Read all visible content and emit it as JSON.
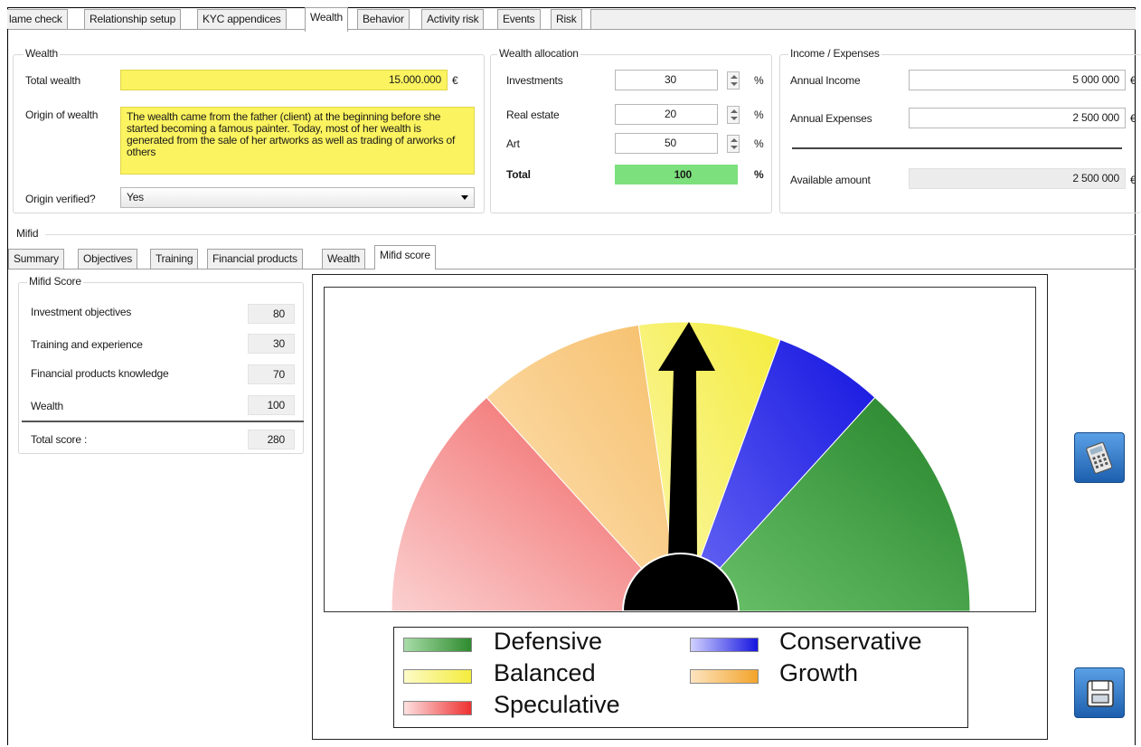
{
  "top_tabs": [
    "lame check",
    "Relationship setup",
    "KYC appendices",
    "Wealth",
    "Behavior",
    "Activity risk",
    "Events",
    "Risk"
  ],
  "wealth": {
    "title": "Wealth",
    "total_label": "Total wealth",
    "total_value": "15.000.000",
    "currency": "€",
    "origin_label": "Origin of wealth",
    "origin_text": "The wealth came from the father (client) at the beginning before she started becoming a famous painter. Today, most of her wealth is generated from the sale of her artworks as well as trading of arworks of others",
    "verified_label": "Origin verified?",
    "verified_value": "Yes"
  },
  "allocation": {
    "title": "Wealth allocation",
    "rows": [
      {
        "label": "Investments",
        "value": "30",
        "unit": "%"
      },
      {
        "label": "Real estate",
        "value": "20",
        "unit": "%"
      },
      {
        "label": "Art",
        "value": "50",
        "unit": "%"
      }
    ],
    "total_label": "Total",
    "total_value": "100",
    "total_unit": "%"
  },
  "income": {
    "title": "Income / Expenses",
    "annual_income_label": "Annual Income",
    "annual_income_value": "5 000 000",
    "annual_expenses_label": "Annual Expenses",
    "annual_expenses_value": "2 500 000",
    "available_label": "Available amount",
    "available_value": "2 500 000",
    "currency": "€"
  },
  "mifid": {
    "title": "Mifid",
    "tabs": [
      "Summary",
      "Objectives",
      "Training",
      "Financial products",
      "Wealth",
      "Mifid score"
    ],
    "score_title": "Mifid Score",
    "scores": [
      {
        "label": "Investment objectives",
        "value": "80"
      },
      {
        "label": "Training and experience",
        "value": "30"
      },
      {
        "label": "Financial products knowledge",
        "value": "70"
      },
      {
        "label": "Wealth",
        "value": "100"
      }
    ],
    "total_label": "Total score :",
    "total_value": "280"
  },
  "gauge": {
    "segments": [
      {
        "name": "Speculative",
        "color": "#f06666"
      },
      {
        "name": "Growth",
        "color": "#f7c77d"
      },
      {
        "name": "Balanced",
        "color": "#f7f061"
      },
      {
        "name": "Conservative",
        "color": "#2a2ae8"
      },
      {
        "name": "Defensive",
        "color": "#2e8b2e"
      }
    ],
    "legend": {
      "defensive": "Defensive",
      "conservative": "Conservative",
      "balanced": "Balanced",
      "growth": "Growth",
      "speculative": "Speculative"
    }
  },
  "icons": {
    "calculator": "calculator-icon",
    "save": "save-icon"
  }
}
